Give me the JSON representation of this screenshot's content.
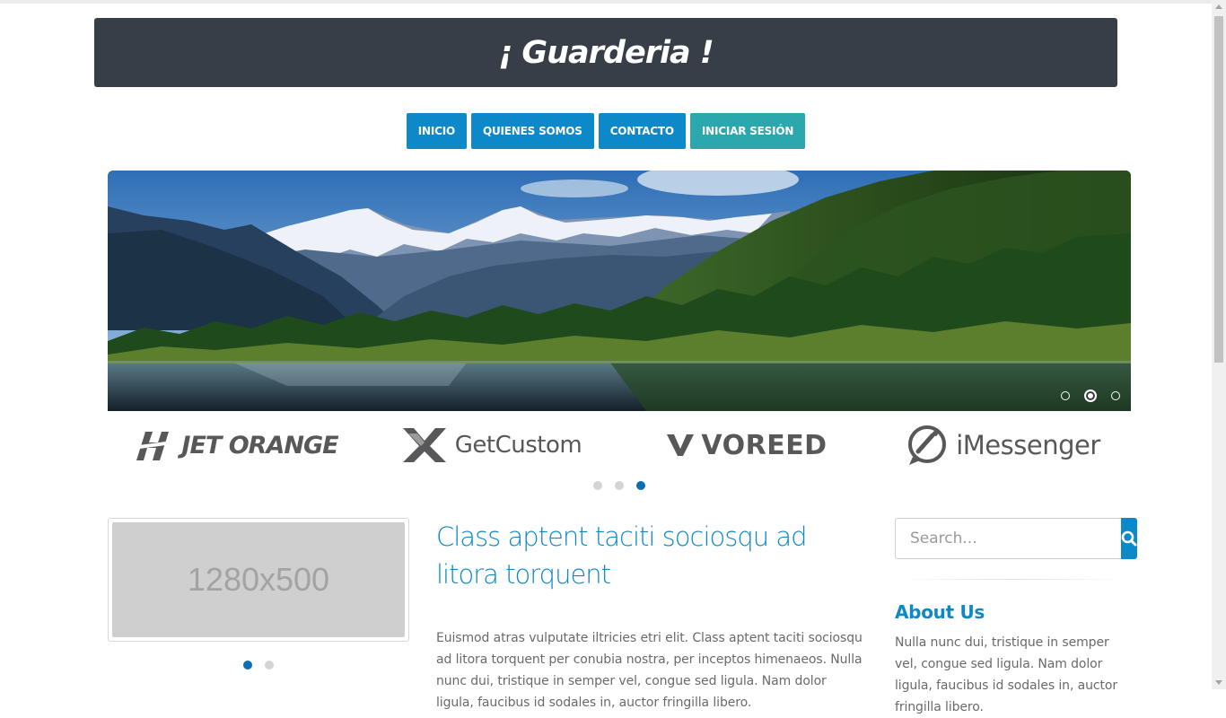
{
  "header": {
    "title": "¡ Guarderia !"
  },
  "nav": {
    "items": [
      {
        "label": "INICIO"
      },
      {
        "label": "QUIENES SOMOS"
      },
      {
        "label": "CONTACTO"
      },
      {
        "label": "INICIAR SESIÓN"
      }
    ]
  },
  "slider": {
    "active_slide": 2,
    "slide_count": 3
  },
  "brands": {
    "items": [
      {
        "label": "JET ORANGE",
        "icon": "jet-orange-logo-icon"
      },
      {
        "label": "GetCustom",
        "icon": "getcustom-logo-icon"
      },
      {
        "label": "VOREED",
        "icon": "voreed-logo-icon"
      },
      {
        "label": "iMessenger",
        "icon": "imessenger-logo-icon"
      }
    ],
    "active_page": 3,
    "page_count": 3
  },
  "thumbnail": {
    "placeholder_text": "1280x500",
    "active_page": 1,
    "page_count": 2
  },
  "post": {
    "title": "Class aptent taciti sociosqu ad litora torquent",
    "body": "Euismod atras vulputate iltricies etri elit. Class aptent taciti sociosqu ad litora torquent per conubia nostra, per inceptos himenaeos. Nulla nunc dui, tristique in semper vel, congue sed ligula. Nam dolor ligula, faucibus id sodales in, auctor fringilla libero."
  },
  "sidebar": {
    "search": {
      "placeholder": "Search...",
      "icon": "search-icon"
    },
    "about": {
      "title": "About Us",
      "body": "Nulla nunc dui, tristique in semper vel, congue sed ligula. Nam dolor ligula, faucibus id sodales in, auctor fringilla libero."
    }
  },
  "colors": {
    "header_bg": "#383e48",
    "primary": "#0d88c9",
    "teal": "#2aa8ad"
  }
}
